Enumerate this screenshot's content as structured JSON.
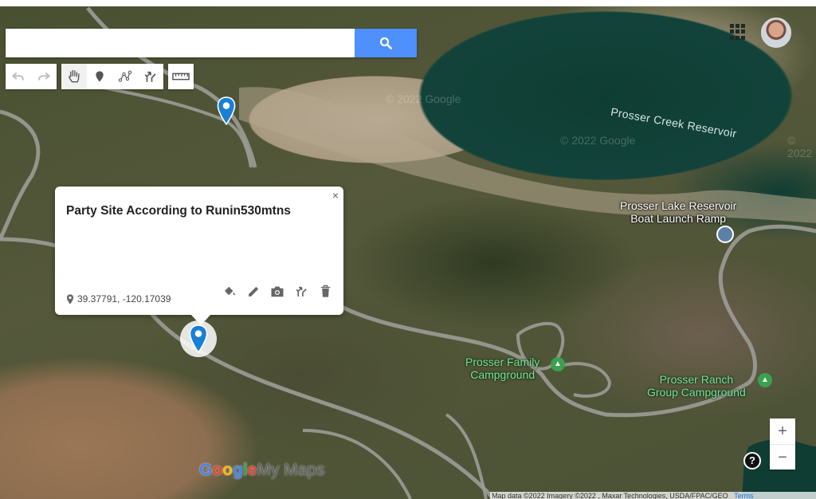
{
  "search": {
    "placeholder": "",
    "value": ""
  },
  "toolbar": {
    "undo_icon": "undo-icon",
    "redo_icon": "redo-icon",
    "pan_icon": "hand-icon",
    "marker_icon": "marker-icon",
    "line_icon": "draw-line-icon",
    "directions_icon": "directions-icon",
    "measure_icon": "ruler-icon"
  },
  "map": {
    "labels": {
      "reservoir": "Prosser Creek Reservoir",
      "boat_launch": "Prosser Lake Reservoir\nBoat Launch Ramp",
      "family_campground_line1": "Prosser Family",
      "family_campground_line2": "Campground",
      "ranch_campground_line1": "Prosser Ranch",
      "ranch_campground_line2": "Group Campground"
    },
    "watermarks": [
      "© 2022 Google",
      "© 2022 Google",
      "© 2022"
    ]
  },
  "info_window": {
    "title": "Party Site According to Runin530mtns",
    "coords": "39.37791, -120.17039",
    "close_label": "×",
    "actions": [
      "paint-bucket-icon",
      "pencil-icon",
      "camera-icon",
      "directions-icon",
      "trash-icon"
    ]
  },
  "controls": {
    "zoom_in": "+",
    "zoom_out": "−",
    "help": "?"
  },
  "footer": {
    "logo_google": "Google",
    "logo_product": "My Maps",
    "attribution": "Map data ©2022 Imagery ©2022 , Maxar Technologies, USDA/FPAC/GEO",
    "terms": "Terms"
  },
  "colors": {
    "pin_blue": "#1a7fd6",
    "search_button": "#4d90fe",
    "campground_green": "#3aa14f"
  }
}
